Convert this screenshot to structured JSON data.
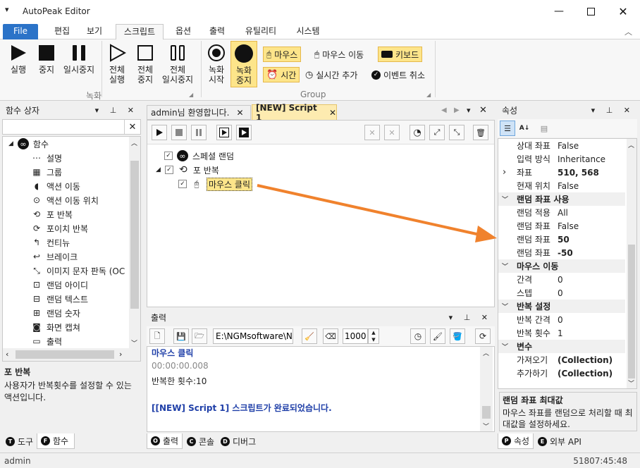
{
  "app": {
    "title": "AutoPeak Editor"
  },
  "ribbon_tabs": [
    "File",
    "편집",
    "보기",
    "스크립트",
    "옵션",
    "출력",
    "유틸리티",
    "시스템"
  ],
  "ribbon": {
    "record_group": {
      "run": "실행",
      "stop": "중지",
      "pause": "일시중지",
      "run_all": "전체\n실행",
      "stop_all": "전체\n중지",
      "pause_all": "전체\n일시중지",
      "label": "녹화"
    },
    "group2": {
      "rec_start": "녹화\n시작",
      "rec_stop": "녹화\n중지",
      "mouse": "마우스",
      "mouse_move": "마우스 이동",
      "keyboard": "키보드",
      "time": "시간",
      "realtime_add": "실시간 추가",
      "event_cancel": "이벤트 취소",
      "label": "Group"
    }
  },
  "function_box": {
    "title": "함수 상자",
    "search_value": "",
    "root": "함수",
    "items": [
      "설명",
      "그룹",
      "액션 이동",
      "액션 이동 위치",
      "포 반복",
      "포이치 반복",
      "컨티뉴",
      "브레이크",
      "이미지 문자 판독 (OC",
      "랜덤 아이디",
      "랜덤 텍스트",
      "랜덤 숫자",
      "화면 캡쳐",
      "출력"
    ],
    "desc_title": "포 반복",
    "desc_text": "사용자가 반복횟수를 설정할 수 있는 액션입니다.",
    "bottom_tabs": [
      {
        "key": "T",
        "label": "도구"
      },
      {
        "key": "F",
        "label": "함수"
      }
    ]
  },
  "editor": {
    "tabs": [
      "admin님 환영합니다.",
      "[NEW] Script 1"
    ],
    "tree": [
      {
        "label": "스페셜 랜덤",
        "checked": true
      },
      {
        "label": "포 반복",
        "checked": true
      },
      {
        "label": "마우스 클릭",
        "checked": true
      }
    ]
  },
  "output": {
    "title": "출력",
    "path": "E:\\NGMsoftware\\NG",
    "count": "1000",
    "lines": [
      "마우스 클릭",
      "00:00:00.008",
      "반복한 횟수:10",
      "",
      "[[NEW] Script 1] 스크립트가 완료되었습니다."
    ],
    "bottom_tabs": [
      {
        "key": "O",
        "label": "출력"
      },
      {
        "key": "C",
        "label": "콘솔"
      },
      {
        "key": "D",
        "label": "디버그"
      }
    ]
  },
  "properties": {
    "title": "속성",
    "rows": [
      {
        "type": "row",
        "key": "상대 좌표",
        "value": "False"
      },
      {
        "type": "row",
        "key": "입력 방식",
        "value": "Inheritance"
      },
      {
        "type": "row",
        "key": "좌표",
        "value": "510, 568",
        "bold": true,
        "expand": true
      },
      {
        "type": "row",
        "key": "현재 위치",
        "value": "False"
      },
      {
        "type": "cat",
        "key": "랜덤 좌표 사용"
      },
      {
        "type": "row",
        "key": "랜덤 적용",
        "value": "All"
      },
      {
        "type": "row",
        "key": "랜덤 좌표",
        "value": "False"
      },
      {
        "type": "row",
        "key": "랜덤 좌표",
        "value": "50",
        "bold": true
      },
      {
        "type": "row",
        "key": "랜덤 좌표",
        "value": "-50",
        "bold": true
      },
      {
        "type": "cat",
        "key": "마우스 이동"
      },
      {
        "type": "row",
        "key": "간격",
        "value": "0"
      },
      {
        "type": "row",
        "key": "스텝",
        "value": "0"
      },
      {
        "type": "cat",
        "key": "반복 설정"
      },
      {
        "type": "row",
        "key": "반복 간격",
        "value": "0"
      },
      {
        "type": "row",
        "key": "반복 횟수",
        "value": "1"
      },
      {
        "type": "cat",
        "key": "변수"
      },
      {
        "type": "row",
        "key": "가져오기",
        "value": "(Collection)",
        "bold": true
      },
      {
        "type": "row",
        "key": "추가하기",
        "value": "(Collection)",
        "bold": true
      }
    ],
    "desc_title": "랜덤 좌표 최대값",
    "desc_text": "마우스 좌표를 랜덤으로 처리할 때 최대값을 설정하세요.",
    "bottom_tabs": [
      {
        "key": "P",
        "label": "속성"
      },
      {
        "key": "E",
        "label": "외부 API"
      }
    ]
  },
  "status": {
    "left": "admin",
    "right": "51807:45:48"
  },
  "colors": {
    "accent": "#2b73c8",
    "highlight": "#fde58a",
    "arrow": "#f0822d",
    "output_blue": "#1f3fa8"
  }
}
